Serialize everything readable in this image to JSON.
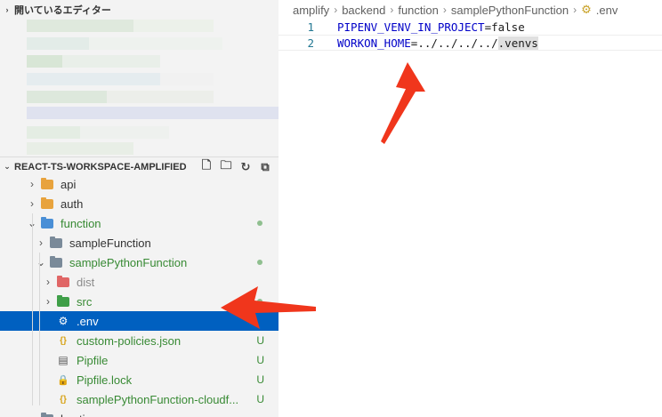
{
  "sidebar": {
    "open_editors_title": "開いているエディター",
    "workspace_title": "REACT-TS-WORKSPACE-AMPLIFIED",
    "tree": [
      {
        "label": "api",
        "type": "folder",
        "color": "#e8a33d",
        "twistie": "›",
        "badge": "",
        "style": ""
      },
      {
        "label": "auth",
        "type": "folder",
        "color": "#e8a33d",
        "twistie": "›",
        "badge": "",
        "style": ""
      },
      {
        "label": "function",
        "type": "folder",
        "color": "#4a8fd6",
        "twistie": "⌄",
        "badge": "dot",
        "style": "green"
      },
      {
        "label": "sampleFunction",
        "type": "folder",
        "color": "#7a8a99",
        "twistie": "›",
        "badge": "",
        "style": ""
      },
      {
        "label": "samplePythonFunction",
        "type": "folder",
        "color": "#7a8a99",
        "twistie": "⌄",
        "badge": "dot",
        "style": "green"
      },
      {
        "label": "dist",
        "type": "folder",
        "color": "#e06666",
        "twistie": "›",
        "badge": "",
        "style": "gray"
      },
      {
        "label": "src",
        "type": "folder",
        "color": "#3f9f48",
        "twistie": "›",
        "badge": "dot",
        "style": "green"
      },
      {
        "label": ".env",
        "type": "env",
        "color": "#ffffff",
        "twistie": "",
        "badge": "",
        "style": "selected"
      },
      {
        "label": "custom-policies.json",
        "type": "json",
        "color": "#d7a317",
        "twistie": "",
        "badge": "U",
        "style": "green"
      },
      {
        "label": "Pipfile",
        "type": "file",
        "color": "#555555",
        "twistie": "",
        "badge": "U",
        "style": "green"
      },
      {
        "label": "Pipfile.lock",
        "type": "lock",
        "color": "#e8b70a",
        "twistie": "",
        "badge": "U",
        "style": "green"
      },
      {
        "label": "samplePythonFunction-cloudf...",
        "type": "json",
        "color": "#d7a317",
        "twistie": "",
        "badge": "U",
        "style": "green"
      },
      {
        "label": "hosting",
        "type": "folder",
        "color": "#7a8a99",
        "twistie": "›",
        "badge": "",
        "style": ""
      }
    ]
  },
  "editor": {
    "breadcrumb": [
      "amplify",
      "backend",
      "function",
      "samplePythonFunction",
      ".env"
    ],
    "lines": [
      {
        "num": "1",
        "key": "PIPENV_VENV_IN_PROJECT",
        "eq": "=",
        "value": "false",
        "highlight": ""
      },
      {
        "num": "2",
        "key": "WORKON_HOME",
        "eq": "=",
        "value": "../../../../",
        "highlight": ".venvs"
      }
    ]
  },
  "colors": {
    "accent_selection": "#0060c0",
    "arrow": "#f0361c",
    "git_green": "#388a34"
  }
}
